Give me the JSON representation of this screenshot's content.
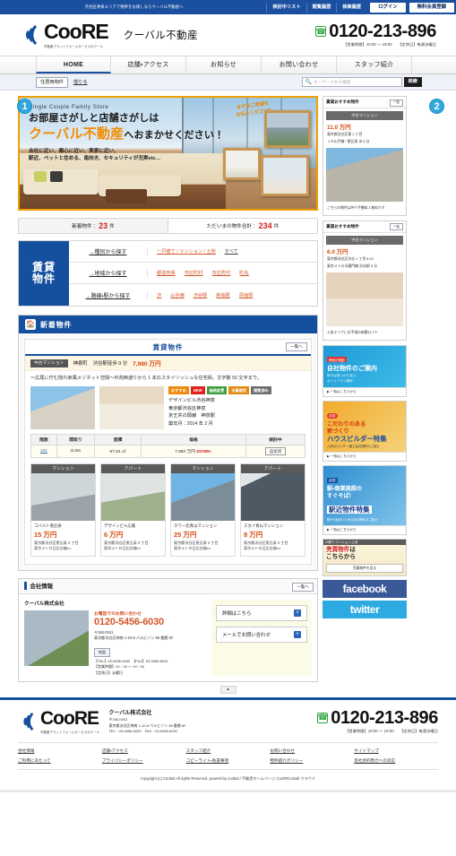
{
  "topbar": {
    "tagline": "渋谷区神泉エリアで物件をお探しならクーバル不動産へ",
    "links": [
      "検討中リスト",
      "閲覧履歴",
      "検索履歴"
    ],
    "login_label": "ログイン",
    "register_label": "無料会員登録"
  },
  "header": {
    "logo_main": "CooRE",
    "logo_sub": "不動産プラットフォームサービスのクール",
    "logo_jp": "クーバル不動産",
    "tel": "0120-213-896",
    "tel_note": "【営業時間】10:00 ～ 19:00　　【定休日】毎週水曜日",
    "phone_icon": "phone-icon"
  },
  "nav": {
    "items": [
      {
        "label": "HOME",
        "active": true
      },
      {
        "label": "店舗・アクセス",
        "active": false
      },
      {
        "label": "お知らせ",
        "active": false
      },
      {
        "label": "お問い合わせ",
        "active": false
      },
      {
        "label": "スタッフ紹介",
        "active": false
      }
    ]
  },
  "searchstrip": {
    "tag_primary": "住居用物件",
    "tag_secondary": "借りる",
    "search_placeholder": "キーワードから検索",
    "search_button": "検索",
    "search_value": "",
    "search_icon": "search-icon"
  },
  "callouts": {
    "one": "1",
    "two": "2"
  },
  "hero": {
    "eyebrow": "Single Couple Family Store",
    "line1": "お部屋さがしと店舗さがしは",
    "line2_orange": "クーバル不動産",
    "line2_black": "へおまかせください！",
    "line3_a": "会社に近い、都心に近い、実家に近い、",
    "line3_b": "駅近、ペットと住める、南向き、セキュリティが充実etc…",
    "bubble_a": "まずはご希望を",
    "bubble_b": "お伝えください!!"
  },
  "stats": {
    "new_label": "新着物件：",
    "new_count": "23",
    "new_unit": "件",
    "total_label": "ただいまの物件合計：",
    "total_count": "234",
    "total_unit": "件"
  },
  "search_panel": {
    "label_a": "賃貸",
    "label_b": "物件",
    "rows": [
      {
        "title": "→種別から探す",
        "links": [
          {
            "text": "一戸建て / マンション / 土地",
            "muted": false
          },
          {
            "text": "すべて",
            "muted": true
          }
        ]
      },
      {
        "title": "→地域から探す",
        "links": [
          {
            "text": "都道府県",
            "muted": false
          },
          {
            "text": "市区町村",
            "muted": false
          },
          {
            "text": "市区町村",
            "muted": false
          },
          {
            "text": "町名",
            "muted": false
          }
        ]
      },
      {
        "title": "→路線・駅から探す",
        "links": [
          {
            "text": "渋",
            "muted": false
          },
          {
            "text": "山手線",
            "muted": false
          },
          {
            "text": "渋谷駅",
            "muted": false
          },
          {
            "text": "新宿駅",
            "muted": false
          },
          {
            "text": "原宿駅",
            "muted": false
          }
        ]
      }
    ]
  },
  "new_section": {
    "header_title": "新着物件",
    "header_icon": "house-icon",
    "sub_title": "賃貸物件",
    "more_label": "一覧へ",
    "featured": {
      "type_badge": "中古マンション",
      "area": "神泉町",
      "station": "渋谷駅徒歩 9 分",
      "price": "7,980 万円",
      "description": "～広尾に佇む隠れ家風メゾネット空間～外苑西通りから 1 本のスタイリッシュな住宅街。文字数 50 文字まで。",
      "tags": [
        {
          "label": "おすすめ",
          "color": "#f0890c"
        },
        {
          "label": "NEW",
          "color": "#e2201c"
        },
        {
          "label": "価格変更",
          "color": "#3f9e3f"
        },
        {
          "label": "会員限定",
          "color": "#e08b14"
        },
        {
          "label": "閲覧済み",
          "color": "#6e6e6e"
        }
      ],
      "name_lines": [
        "デザインビル渋谷神泉",
        "東京都渋谷区神泉",
        "京王井の頭線　神泉駅",
        "築年月：2014 年 2 月"
      ],
      "table_headers": [
        "階数",
        "間取り",
        "面積",
        "価格",
        "検討中"
      ],
      "table_row": {
        "floor": "101",
        "layout": "2LDK",
        "area": "97.64 ㎡",
        "price": "7,980 万円",
        "price_flag": "DOWN↓",
        "action": "追加済"
      }
    },
    "cards": [
      {
        "type": "マンション",
        "title": "コバルト恵比寿",
        "price": "15 万円",
        "addr1": "東京都渋谷区恵比寿 2 丁目",
        "addr2": "東京メトロ日比谷線・・・"
      },
      {
        "type": "アパート",
        "title": "デザインビル広尾",
        "price": "6 万円",
        "addr1": "東京都渋谷区恵比寿 2 丁目",
        "addr2": "東京メトロ日比谷線・・・"
      },
      {
        "type": "マンション",
        "title": "タワー北青山マンション",
        "price": "25 万円",
        "addr1": "東京都渋谷区恵比寿 2 丁目",
        "addr2": "東京メトロ日比谷線・・・"
      },
      {
        "type": "アパート",
        "title": "スカイ青山マンション",
        "price": "8 万円",
        "addr1": "東京都渋谷区恵比寿 2 丁目",
        "addr2": "東京メトロ日比谷線・・・"
      }
    ]
  },
  "company": {
    "section_title": "会社情報",
    "more_label": "一覧へ",
    "name": "クーバル株式会社",
    "contact_label": "お電話でのお問い合わせ",
    "tel": "0120-5456-6030",
    "zip": "〒150-0041",
    "address": "東京都渋谷区神南 1-10-6 バルビゾン 98 番館 6F",
    "map_label": "地図",
    "meta1": "【TEL】03-5456-6030　【FAX】03-5456-6031",
    "meta2": "【営業時間】10：00 ～ 19：00",
    "meta3": "【定休日】水曜日",
    "cta1": "詳細はこちら",
    "cta2": "メールでお問い合わせ"
  },
  "sidebar": {
    "recommend_panels": [
      {
        "head": "賃貸おすすめ物件",
        "more": "一覧",
        "type": "中古マンション",
        "price": "11.0 万円",
        "addr1": "東京都渋谷区東 2 丁目",
        "addr2": "ＪＲ山手線 / 恵比寿 歩 6 分",
        "note": "こちらの物件は仲介手数料１無料です"
      },
      {
        "head": "賃貸おすすめ物件",
        "more": "一覧",
        "type": "中古マンション",
        "price": "6.0 万円",
        "addr1": "東京都渋谷区渋谷 1 丁目 8-10",
        "addr2": "東京メトロ半蔵門線 渋谷駅 5 分",
        "note": "人気エリアにお手頃の新築ロフト"
      }
    ],
    "banners": [
      {
        "style": "sb1",
        "kicker": "情報が満載!",
        "title": "自社物件のご案内",
        "sub1": "他では見つからない",
        "sub2": "オンリーワン物件!",
        "cta": "▶ 一覧はこちらから"
      },
      {
        "style": "sb2",
        "kicker": "必見!",
        "title": "こだわりのある",
        "title_b": "家づくり",
        "title_c": "ハウスビルダー特集",
        "sub": "人気のビルダー・施工会社物件のご紹介",
        "cta": "▶ 一覧はこちらから"
      },
      {
        "style": "sb3",
        "kicker": "必見!",
        "title": "駅・商業施設の",
        "title_b": "すぐそば!",
        "title_c": "駅近物件特集",
        "sub": "駅から徒歩 10 分以内の物件のご紹介",
        "cta": "▶ 一覧はこちらから"
      },
      {
        "style": "sb4",
        "kicker": "戸建て・マンション・土地",
        "title_a": "売買物件",
        "title_b": "は",
        "title_c": "こちらから",
        "btn": "売買物件を見る"
      }
    ],
    "social": [
      {
        "label": "facebook",
        "class": "fb"
      },
      {
        "label": "twitter",
        "class": "tw"
      }
    ]
  },
  "pagetop": {
    "label": "▲"
  },
  "footer": {
    "logo_main": "CooRE",
    "logo_sub": "不動産プラットフォームサービスのクール",
    "co_name": "クーバル株式会社",
    "co_zip": "〒150-0041",
    "co_addr": "東京都渋谷区神南 1-10-6 バルビゾン 98 番館 6F",
    "co_tel": "TEL：03-5456-6030　FAX：03-5456-6031",
    "tel": "0120-213-896",
    "tel_note": "【営業時間】10:00 ～ 19:00　　【定休日】毎週水曜日",
    "links": [
      [
        "会社情報",
        "ご利用にあたって"
      ],
      [
        "店舗・アクセス",
        "プライバシーポリシー"
      ],
      [
        "スタッフ紹介",
        "コピーライト・免責事項"
      ],
      [
        "お問い合わせ",
        "物件紹介ポリシー"
      ],
      [
        "サイトマップ",
        "反社会的勢力への対応"
      ]
    ],
    "copyright": "Copyright  (c)  Coobal All rights Reserved. powerd by coobal / 不動産ホームページ CooRECobalt クラウド"
  }
}
